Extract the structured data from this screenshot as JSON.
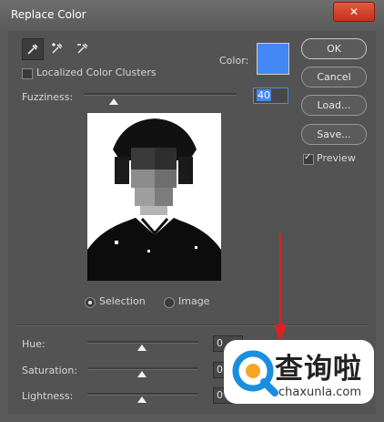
{
  "window": {
    "title": "Replace Color",
    "close_icon": "close-icon"
  },
  "tools": [
    {
      "name": "eyedropper-icon",
      "glyph": "✎",
      "active": true
    },
    {
      "name": "eyedropper-plus-icon",
      "glyph": "✎",
      "active": false
    },
    {
      "name": "eyedropper-minus-icon",
      "glyph": "✎",
      "active": false
    }
  ],
  "localized_color_clusters": {
    "label": "Localized Color Clusters",
    "checked": false
  },
  "color": {
    "label": "Color:",
    "value": "#4388f4"
  },
  "fuzziness": {
    "label": "Fuzziness:",
    "value": "40",
    "level_fraction": 0.2
  },
  "buttons": {
    "ok": "OK",
    "cancel": "Cancel",
    "load": "Load...",
    "save": "Save..."
  },
  "preview_checkbox": {
    "label": "Preview",
    "checked": true
  },
  "view_mode": {
    "selection_label": "Selection",
    "image_label": "Image",
    "selected": "selection"
  },
  "hue": {
    "label": "Hue:",
    "value": "0"
  },
  "saturation": {
    "label": "Saturation:",
    "value": "0"
  },
  "lightness": {
    "label": "Lightness:",
    "value": "0"
  },
  "watermark": {
    "cn": "查询啦",
    "en": "chaxunla.com",
    "brand_color": "#1a8fe0"
  },
  "annotation": {
    "arrow_color": "#e02020"
  }
}
